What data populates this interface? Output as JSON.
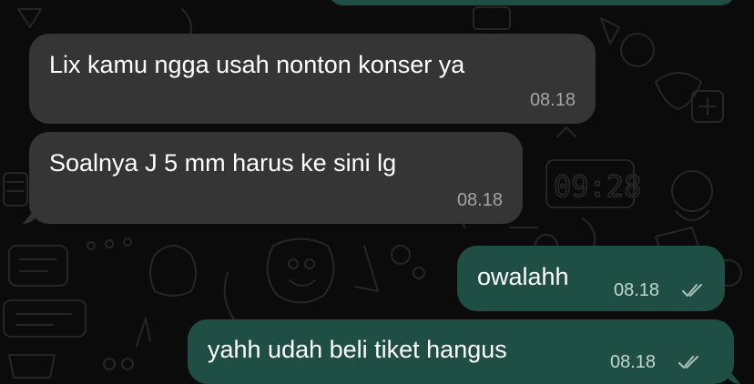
{
  "chat": {
    "messages": [
      {
        "direction": "incoming",
        "text": "Lix kamu ngga usah nonton konser ya",
        "time": "08.18"
      },
      {
        "direction": "incoming",
        "text": "Soalnya J 5 mm harus ke sini lg",
        "time": "08.18"
      },
      {
        "direction": "outgoing",
        "text": "owalahh",
        "time": "08.18",
        "status": "read"
      },
      {
        "direction": "outgoing",
        "text": "yahh udah beli tiket hangus",
        "time": "08.18",
        "status": "read"
      }
    ]
  },
  "colors": {
    "background": "#0b0b0b",
    "incoming_bubble": "#353535",
    "outgoing_bubble": "#1f4e44",
    "text": "#ffffff",
    "timestamp": "#a5a5a5"
  },
  "icons": {
    "read_receipt": "double-check-icon",
    "wallpaper": "doodle-pattern"
  }
}
